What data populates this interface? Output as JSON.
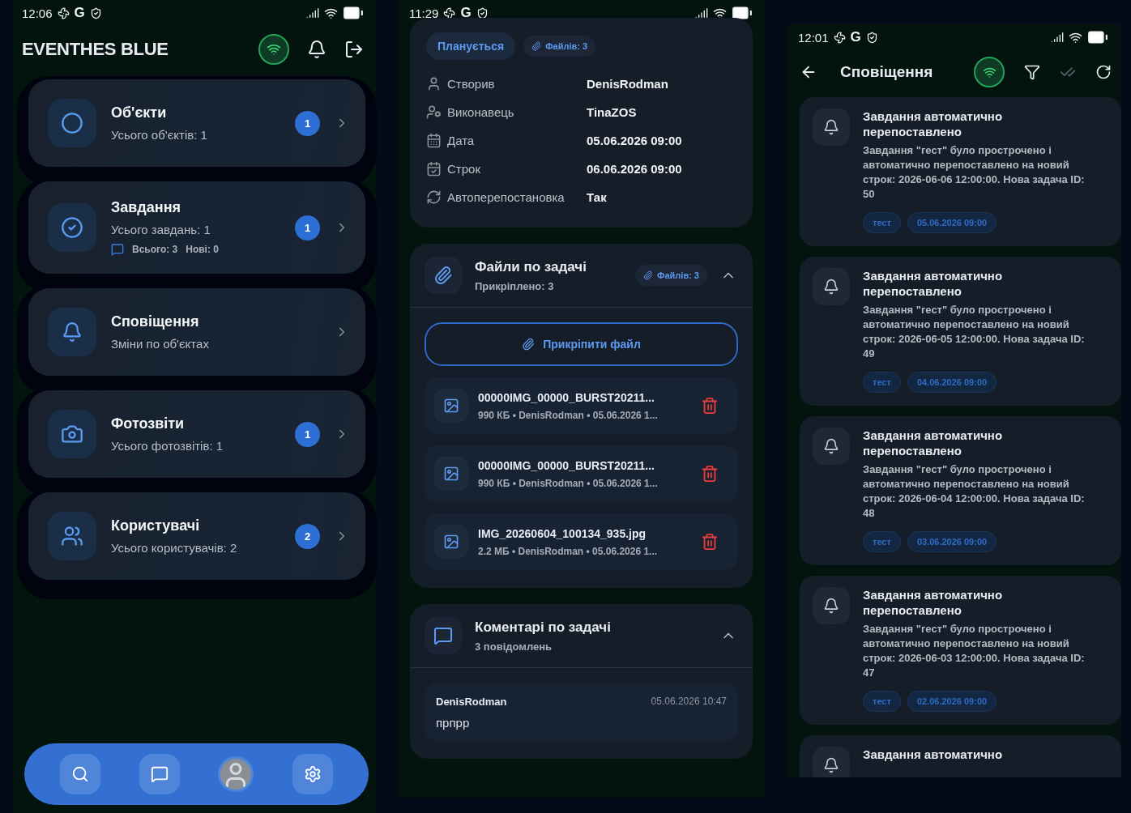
{
  "home": {
    "status": {
      "time": "12:06",
      "glyph": "G"
    },
    "title": "EVENTHES BLUE",
    "online": true,
    "items": [
      {
        "kind": "objects",
        "title": "Об'єкти",
        "subtitle": "Усього об'єктів: 1",
        "count": "1"
      },
      {
        "kind": "tasks",
        "title": "Завдання",
        "subtitle": "Усього завдань: 1",
        "count": "1",
        "comments": {
          "total": "Всього: 3",
          "new": "Нові: 0"
        }
      },
      {
        "kind": "notifications",
        "title": "Сповіщення",
        "subtitle": "Зміни по об'єктах"
      },
      {
        "kind": "photos",
        "title": "Фотозвіти",
        "subtitle": "Усього фотозвітів: 1",
        "count": "1"
      },
      {
        "kind": "users",
        "title": "Користувачі",
        "subtitle": "Усього користувачів: 2",
        "count": "2"
      }
    ],
    "nav": [
      {
        "kind": "search"
      },
      {
        "kind": "chat"
      },
      {
        "kind": "avatar"
      },
      {
        "kind": "settings"
      }
    ]
  },
  "task": {
    "status": {
      "time": "11:29",
      "glyph": "G"
    },
    "state_chip": "Планується",
    "files_chip": "Файлів: 3",
    "details": [
      {
        "kind": "creator",
        "label": "Створив",
        "value": "DenisRodman"
      },
      {
        "kind": "assignee",
        "label": "Виконавець",
        "value": "TinaZOS"
      },
      {
        "kind": "date",
        "label": "Дата",
        "value": "05.06.2026 09:00"
      },
      {
        "kind": "deadline",
        "label": "Строк",
        "value": "06.06.2026 09:00"
      },
      {
        "kind": "repeat",
        "label": "Автоперепостановка",
        "value": "Так"
      }
    ],
    "files_section": {
      "title": "Файли по задачі",
      "subtitle": "Прикріплено: 3",
      "chip": "Файлів: 3",
      "expanded": true
    },
    "attach_button": "Прикріпити файл",
    "files": [
      {
        "name": "00000IMG_00000_BURST20211...",
        "meta": "990 КБ • DenisRodman • 05.06.2026 1..."
      },
      {
        "name": "00000IMG_00000_BURST20211...",
        "meta": "990 КБ • DenisRodman • 05.06.2026 1..."
      },
      {
        "name": "IMG_20260604_100134_935.jpg",
        "meta": "2.2 МБ • DenisRodman • 05.06.2026 1..."
      }
    ],
    "comments_section": {
      "title": "Коментарі по задачі",
      "subtitle": "3 повідомлень",
      "expanded": true
    },
    "comments": [
      {
        "author": "DenisRodman",
        "time": "05.06.2026 10:47",
        "text": "прпрр"
      }
    ]
  },
  "notifications": {
    "status": {
      "time": "12:01",
      "glyph": "G"
    },
    "title": "Сповіщення",
    "online": true,
    "items": [
      {
        "title": "Завдання автоматично перепоставлено",
        "body": "Завдання \"гест\" було прострочено і автоматично перепоставлено на новий строк: 2026-06-06 12:00:00. Нова задача ID: 50",
        "tag": "тест",
        "date": "05.06.2026 09:00"
      },
      {
        "title": "Завдання автоматично перепоставлено",
        "body": "Завдання \"гест\" було прострочено і автоматично перепоставлено на новий строк: 2026-06-05 12:00:00. Нова задача ID: 49",
        "tag": "тест",
        "date": "04.06.2026 09:00"
      },
      {
        "title": "Завдання автоматично перепоставлено",
        "body": "Завдання \"гест\" було прострочено і автоматично перепоставлено на новий строк: 2026-06-04 12:00:00. Нова задача ID: 48",
        "tag": "тест",
        "date": "03.06.2026 09:00"
      },
      {
        "title": "Завдання автоматично перепоставлено",
        "body": "Завдання \"гест\" було прострочено і автоматично перепоставлено на новий строк: 2026-06-03 12:00:00. Нова задача ID: 47",
        "tag": "тест",
        "date": "02.06.2026 09:00"
      }
    ],
    "partial_title": "Завдання автоматично"
  }
}
